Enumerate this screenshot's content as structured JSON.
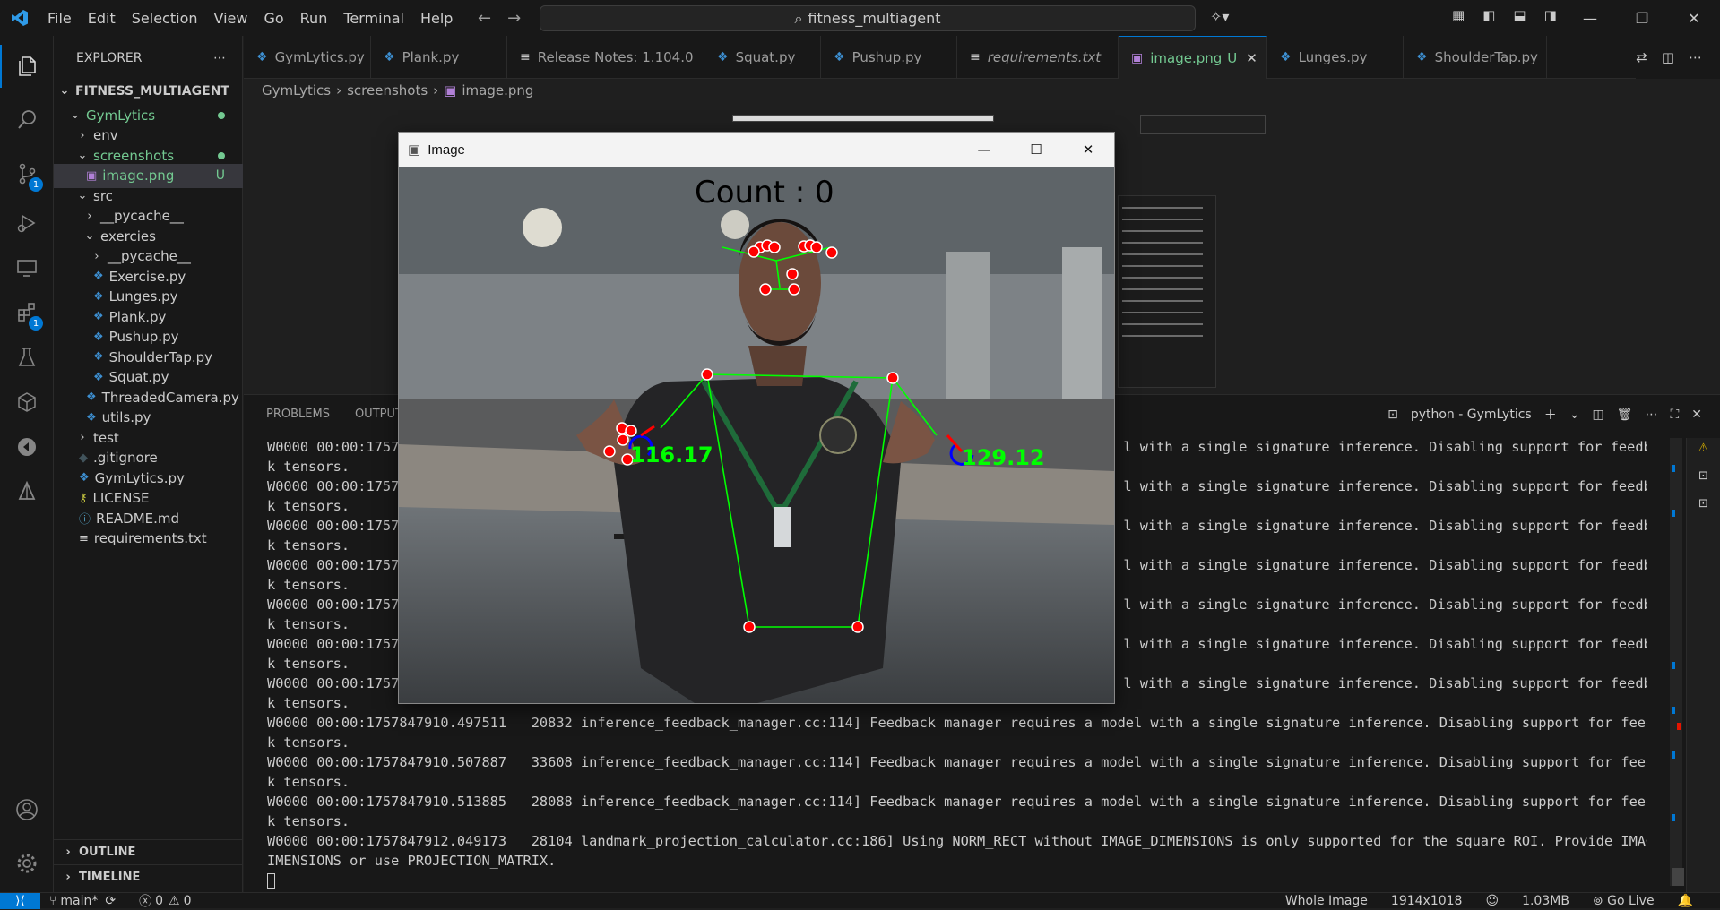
{
  "menu": [
    "File",
    "Edit",
    "Selection",
    "View",
    "Go",
    "Run",
    "Terminal",
    "Help"
  ],
  "command_center": "fitness_multiagent",
  "explorer": {
    "title": "EXPLORER",
    "root": "FITNESS_MULTIAGENT",
    "tree": [
      {
        "label": "GymLytics",
        "level": 1,
        "type": "folder-open",
        "status": "dot",
        "color": "#73c991"
      },
      {
        "label": "env",
        "level": 2,
        "type": "folder-closed"
      },
      {
        "label": "screenshots",
        "level": 2,
        "type": "folder-open",
        "status": "dot",
        "color": "#73c991"
      },
      {
        "label": "image.png",
        "level": 3,
        "type": "image",
        "status": "U",
        "color": "#73c991",
        "selected": true
      },
      {
        "label": "src",
        "level": 2,
        "type": "folder-open"
      },
      {
        "label": "__pycache__",
        "level": 3,
        "type": "folder-closed"
      },
      {
        "label": "exercies",
        "level": 3,
        "type": "folder-open"
      },
      {
        "label": "__pycache__",
        "level": 4,
        "type": "folder-closed"
      },
      {
        "label": "Exercise.py",
        "level": 4,
        "type": "python"
      },
      {
        "label": "Lunges.py",
        "level": 4,
        "type": "python"
      },
      {
        "label": "Plank.py",
        "level": 4,
        "type": "python"
      },
      {
        "label": "Pushup.py",
        "level": 4,
        "type": "python"
      },
      {
        "label": "ShoulderTap.py",
        "level": 4,
        "type": "python"
      },
      {
        "label": "Squat.py",
        "level": 4,
        "type": "python"
      },
      {
        "label": "ThreadedCamera.py",
        "level": 3,
        "type": "python"
      },
      {
        "label": "utils.py",
        "level": 3,
        "type": "python"
      },
      {
        "label": "test",
        "level": 2,
        "type": "folder-closed"
      },
      {
        "label": ".gitignore",
        "level": 2,
        "type": "gitignore"
      },
      {
        "label": "GymLytics.py",
        "level": 2,
        "type": "python"
      },
      {
        "label": "LICENSE",
        "level": 2,
        "type": "license"
      },
      {
        "label": "README.md",
        "level": 2,
        "type": "info"
      },
      {
        "label": "requirements.txt",
        "level": 2,
        "type": "text"
      }
    ],
    "outline": "OUTLINE",
    "timeline": "TIMELINE"
  },
  "tabs": [
    {
      "label": "GymLytics.py",
      "icon": "python-icon"
    },
    {
      "label": "Plank.py",
      "icon": "python-icon"
    },
    {
      "label": "Release Notes: 1.104.0",
      "icon": "release-notes-icon"
    },
    {
      "label": "Squat.py",
      "icon": "python-icon"
    },
    {
      "label": "Pushup.py",
      "icon": "python-icon"
    },
    {
      "label": "requirements.txt",
      "icon": "text-icon",
      "italic": true
    },
    {
      "label": "image.png",
      "icon": "image-icon",
      "active": true,
      "status": "U"
    },
    {
      "label": "Lunges.py",
      "icon": "python-icon"
    },
    {
      "label": "ShoulderTap.py",
      "icon": "python-icon"
    }
  ],
  "breadcrumb": [
    "GymLytics",
    "screenshots",
    "image.png"
  ],
  "panel": {
    "tabs": [
      "PROBLEMS",
      "OUTPUT"
    ],
    "terminal_name": "python - GymLytics",
    "lines": [
      "W0000 00:00:1757",
      "k tensors.",
      "W0000 00:00:1757",
      "k tensors.",
      "W0000 00:00:1757",
      "k tensors.",
      "W0000 00:00:1757",
      "k tensors.",
      "W0000 00:00:1757",
      "k tensors.",
      "W0000 00:00:1757",
      "k tensors.",
      "W0000 00:00:1757",
      "k tensors.",
      "W0000 00:00:1757847910.497511   20832 inference_feedback_manager.cc:114] Feedback manager requires a model with a single signature inference. Disabling support for feedbac",
      "k tensors.",
      "W0000 00:00:1757847910.507887   33608 inference_feedback_manager.cc:114] Feedback manager requires a model with a single signature inference. Disabling support for feedbac",
      "k tensors.",
      "W0000 00:00:1757847910.513885   28088 inference_feedback_manager.cc:114] Feedback manager requires a model with a single signature inference. Disabling support for feedbac",
      "k tensors.",
      "W0000 00:00:1757847912.049173   28104 landmark_projection_calculator.cc:186] Using NORM_RECT without IMAGE_DIMENSIONS is only supported for the square ROI. Provide IMAGE_D",
      "IMENSIONS or use PROJECTION_MATRIX."
    ],
    "partial_tail": "l with a single signature inference. Disabling support for feedbac"
  },
  "image_window": {
    "title": "Image",
    "count_text": "Count : 0",
    "left_angle": "116.17",
    "right_angle": "129.12"
  },
  "status": {
    "branch": "main*",
    "errors": "0",
    "warnings": "0",
    "mode": "Whole Image",
    "dimensions": "1914x1018",
    "size": "1.03MB",
    "golive": "Go Live"
  },
  "colors": {
    "accent": "#0078d4",
    "untracked": "#73c991",
    "pose_green": "#00ff00",
    "pose_red": "#ff0000"
  }
}
